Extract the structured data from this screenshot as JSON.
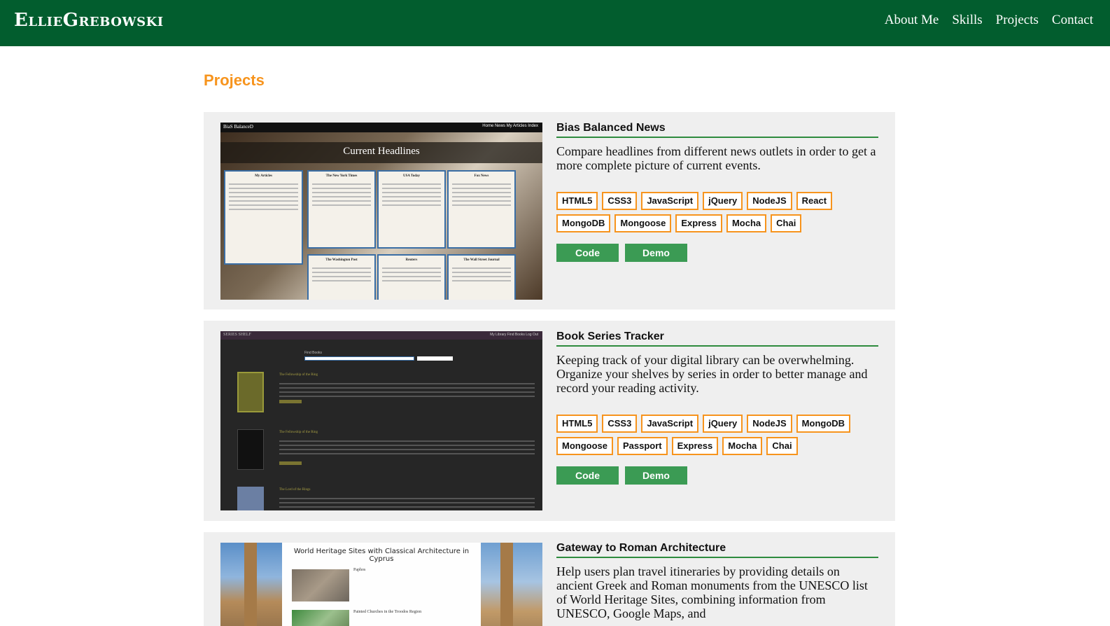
{
  "navbar": {
    "brand": "EllieGrebowski",
    "links": [
      "About Me",
      "Skills",
      "Projects",
      "Contact"
    ]
  },
  "section_title": "Projects",
  "projects": [
    {
      "title": "Bias Balanced News",
      "description": "Compare headlines from different news outlets in order to get a more complete picture of current events.",
      "tags": [
        "HTML5",
        "CSS3",
        "JavaScript",
        "jQuery",
        "NodeJS",
        "React",
        "MongoDB",
        "Mongoose",
        "Express",
        "Mocha",
        "Chai"
      ],
      "code_label": "Code",
      "demo_label": "Demo",
      "thumb": {
        "site_title": "BiaS BalanceD",
        "site_links": "Home  News  My Articles  Index",
        "banner": "Current Headlines",
        "columns": [
          "My Articles",
          "The New York Times",
          "USA Today",
          "Fox News",
          "The Washington Post",
          "Reuters",
          "The Wall Street Journal"
        ]
      }
    },
    {
      "title": "Book Series Tracker",
      "description": "Keeping track of your digital library can be overwhelming. Organize your shelves by series in order to better manage and record your reading activity.",
      "tags": [
        "HTML5",
        "CSS3",
        "JavaScript",
        "jQuery",
        "NodeJS",
        "MongoDB",
        "Mongoose",
        "Passport",
        "Express",
        "Mocha",
        "Chai"
      ],
      "code_label": "Code",
      "demo_label": "Demo",
      "thumb": {
        "site_title": "SERIES SHELF",
        "site_links": "My Library  Find Books  Log Out",
        "search_label": "Find Books",
        "books": [
          "The Fellowship of the Ring",
          "The Fellowship of the Ring",
          "The Lord of the Rings"
        ]
      }
    },
    {
      "title": "Gateway to Roman Architecture",
      "description": "Help users plan travel itineraries by providing details on ancient Greek and Roman monuments from the UNESCO list of World Heritage Sites, combining information from UNESCO, Google Maps, and",
      "thumb": {
        "heading": "World Heritage Sites with Classical Architecture in Cyprus",
        "sites": [
          "Paphos",
          "Painted Churches in the Troodos Region"
        ]
      }
    }
  ],
  "colors": {
    "navbar": "#025d2e",
    "accent": "#f7941d",
    "button": "#3b9b54",
    "card": "#efefef"
  }
}
